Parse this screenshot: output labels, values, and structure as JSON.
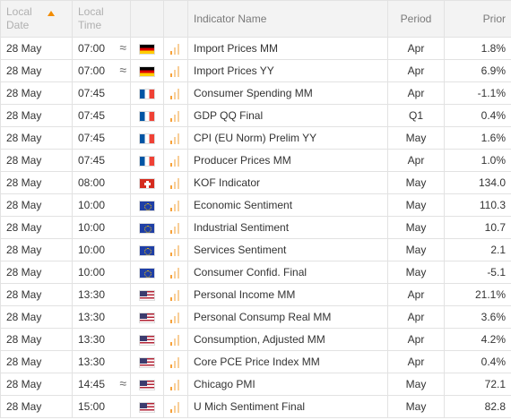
{
  "header": {
    "date": "Local Date",
    "time": "Local Time",
    "name": "Indicator Name",
    "period": "Period",
    "prior": "Prior"
  },
  "rows": [
    {
      "date": "28 May",
      "time": "07:00",
      "approx": "≈",
      "flag": "de",
      "name": "Import Prices MM",
      "period": "Apr",
      "prior": "1.8%"
    },
    {
      "date": "28 May",
      "time": "07:00",
      "approx": "≈",
      "flag": "de",
      "name": "Import Prices YY",
      "period": "Apr",
      "prior": "6.9%"
    },
    {
      "date": "28 May",
      "time": "07:45",
      "approx": "",
      "flag": "fr",
      "name": "Consumer Spending MM",
      "period": "Apr",
      "prior": "-1.1%"
    },
    {
      "date": "28 May",
      "time": "07:45",
      "approx": "",
      "flag": "fr",
      "name": "GDP QQ Final",
      "period": "Q1",
      "prior": "0.4%"
    },
    {
      "date": "28 May",
      "time": "07:45",
      "approx": "",
      "flag": "fr",
      "name": "CPI (EU Norm) Prelim YY",
      "period": "May",
      "prior": "1.6%"
    },
    {
      "date": "28 May",
      "time": "07:45",
      "approx": "",
      "flag": "fr",
      "name": "Producer Prices MM",
      "period": "Apr",
      "prior": "1.0%"
    },
    {
      "date": "28 May",
      "time": "08:00",
      "approx": "",
      "flag": "ch",
      "name": "KOF Indicator",
      "period": "May",
      "prior": "134.0"
    },
    {
      "date": "28 May",
      "time": "10:00",
      "approx": "",
      "flag": "eu",
      "name": "Economic Sentiment",
      "period": "May",
      "prior": "110.3"
    },
    {
      "date": "28 May",
      "time": "10:00",
      "approx": "",
      "flag": "eu",
      "name": "Industrial Sentiment",
      "period": "May",
      "prior": "10.7"
    },
    {
      "date": "28 May",
      "time": "10:00",
      "approx": "",
      "flag": "eu",
      "name": "Services Sentiment",
      "period": "May",
      "prior": "2.1"
    },
    {
      "date": "28 May",
      "time": "10:00",
      "approx": "",
      "flag": "eu",
      "name": "Consumer Confid. Final",
      "period": "May",
      "prior": "-5.1"
    },
    {
      "date": "28 May",
      "time": "13:30",
      "approx": "",
      "flag": "us",
      "name": "Personal Income MM",
      "period": "Apr",
      "prior": "21.1%"
    },
    {
      "date": "28 May",
      "time": "13:30",
      "approx": "",
      "flag": "us",
      "name": "Personal Consump Real MM",
      "period": "Apr",
      "prior": "3.6%"
    },
    {
      "date": "28 May",
      "time": "13:30",
      "approx": "",
      "flag": "us",
      "name": "Consumption, Adjusted MM",
      "period": "Apr",
      "prior": "4.2%"
    },
    {
      "date": "28 May",
      "time": "13:30",
      "approx": "",
      "flag": "us",
      "name": "Core PCE Price Index MM",
      "period": "Apr",
      "prior": "0.4%"
    },
    {
      "date": "28 May",
      "time": "14:45",
      "approx": "≈",
      "flag": "us",
      "name": "Chicago PMI",
      "period": "May",
      "prior": "72.1"
    },
    {
      "date": "28 May",
      "time": "15:00",
      "approx": "",
      "flag": "us",
      "name": "U Mich Sentiment Final",
      "period": "May",
      "prior": "82.8"
    }
  ],
  "colors": {
    "accent": "#f28c00",
    "header_bg": "#f3f3f3",
    "border": "#e2e2e2"
  }
}
